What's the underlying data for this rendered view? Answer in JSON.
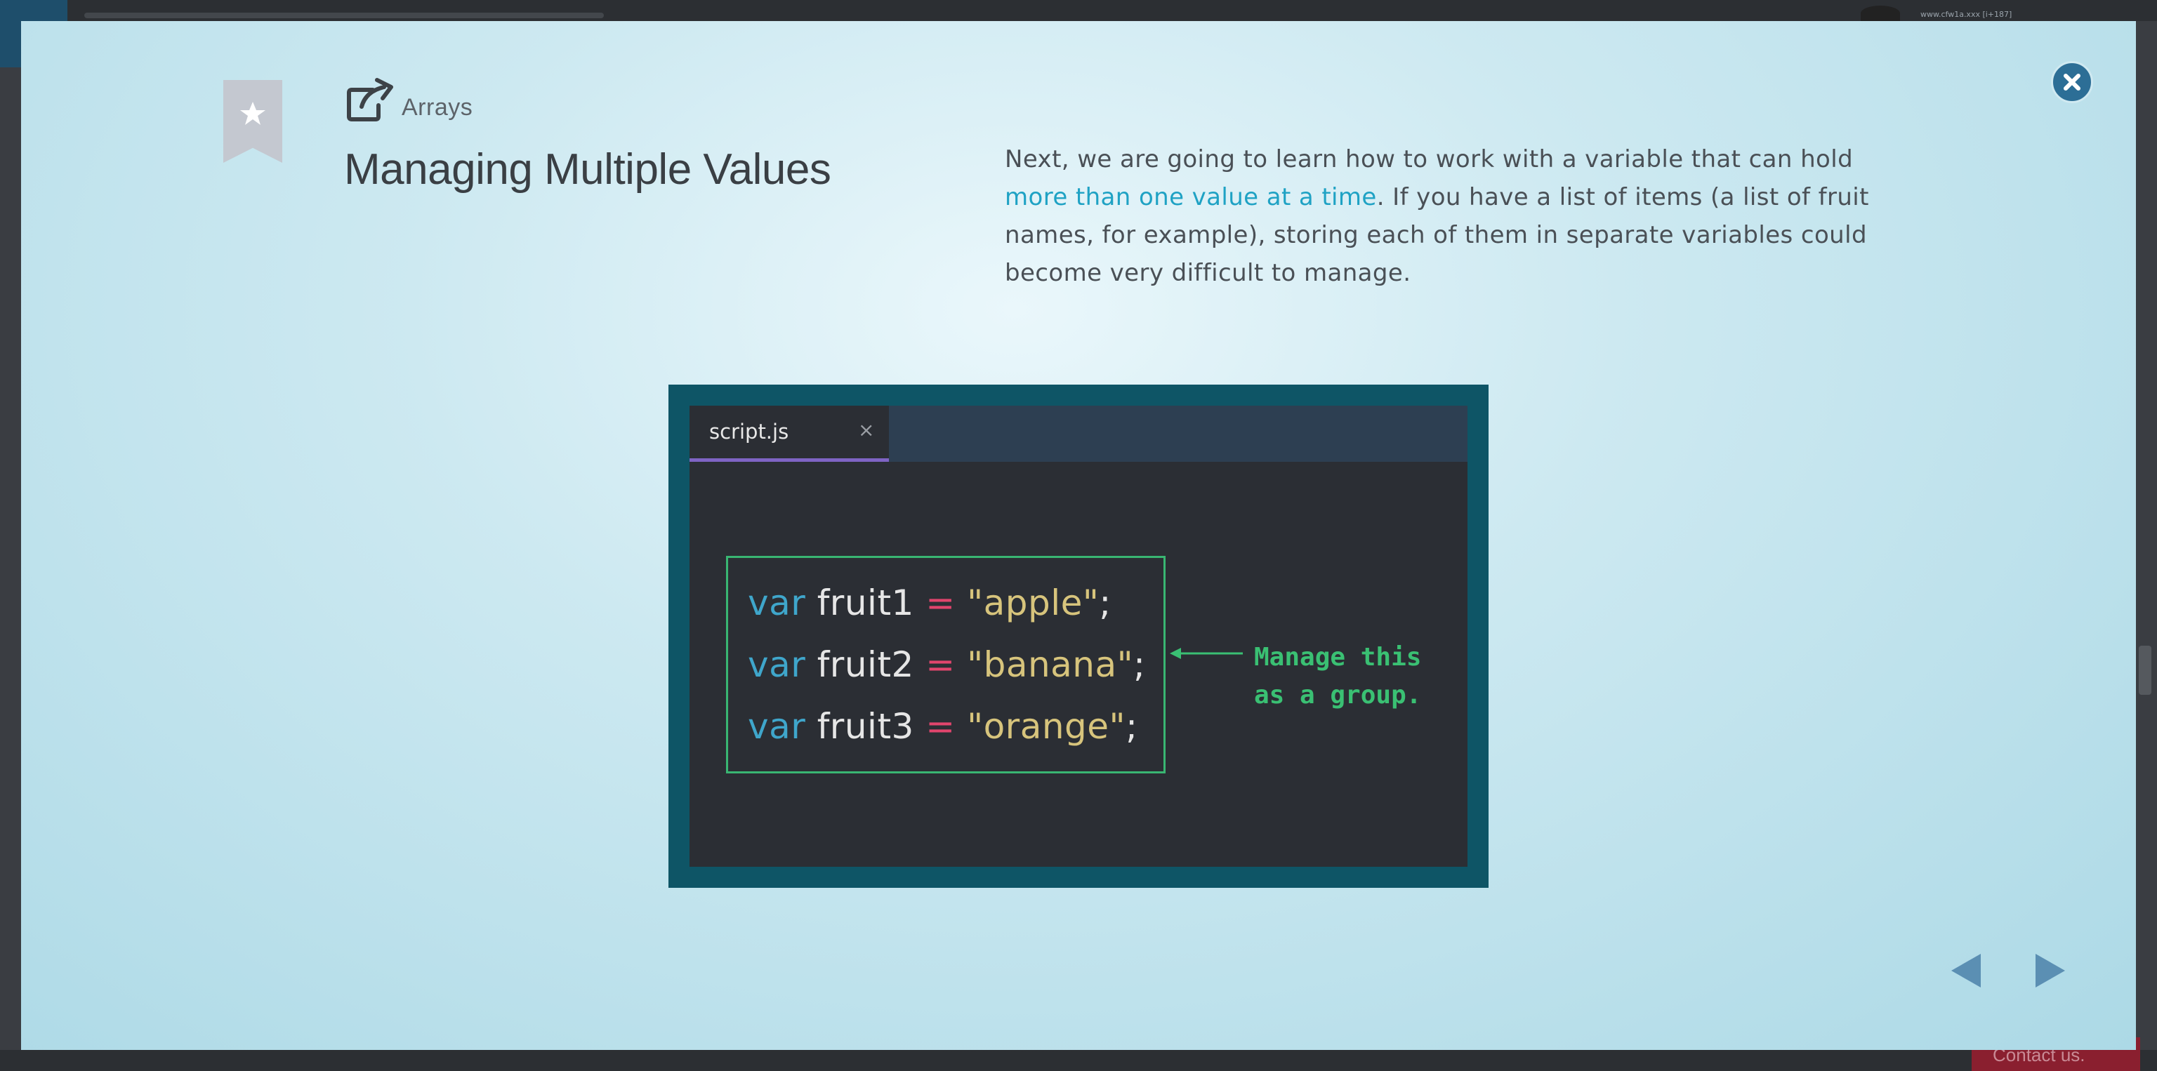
{
  "background": {
    "url_text": "www.cfw1a.xxx [i+187]",
    "contact_label": "Contact us."
  },
  "modal": {
    "category": "Arrays",
    "title": "Managing Multiple Values",
    "description": {
      "part1": "Next, we are going to learn how to work with a variable that can hold ",
      "highlight": "more than one value at a time",
      "part2": ". If you have a list of items (a list of fruit names, for example), storing each of them in separate variables could become very difficult to manage."
    },
    "editor": {
      "tab_label": "script.js",
      "tab_close": "×",
      "lines": [
        {
          "keyword": "var",
          "name": "fruit1",
          "op": "=",
          "value": "\"apple\"",
          "end": ";"
        },
        {
          "keyword": "var",
          "name": "fruit2",
          "op": "=",
          "value": "\"banana\"",
          "end": ";"
        },
        {
          "keyword": "var",
          "name": "fruit3",
          "op": "=",
          "value": "\"orange\"",
          "end": ";"
        }
      ],
      "annotation": "Manage this\nas a group."
    }
  },
  "colors": {
    "highlight": "#1fa2c4",
    "keyword": "#3fa6cb",
    "operator": "#e2456d",
    "string": "#d7c47c",
    "annotation": "#3ac073",
    "close_button": "#2c6e96",
    "nav_arrows": "#5b8fb3"
  },
  "icons": {
    "close": "close-icon",
    "bookmark": "bookmark-star-icon",
    "external": "external-link-icon",
    "prev": "triangle-left-icon",
    "next": "triangle-right-icon"
  }
}
